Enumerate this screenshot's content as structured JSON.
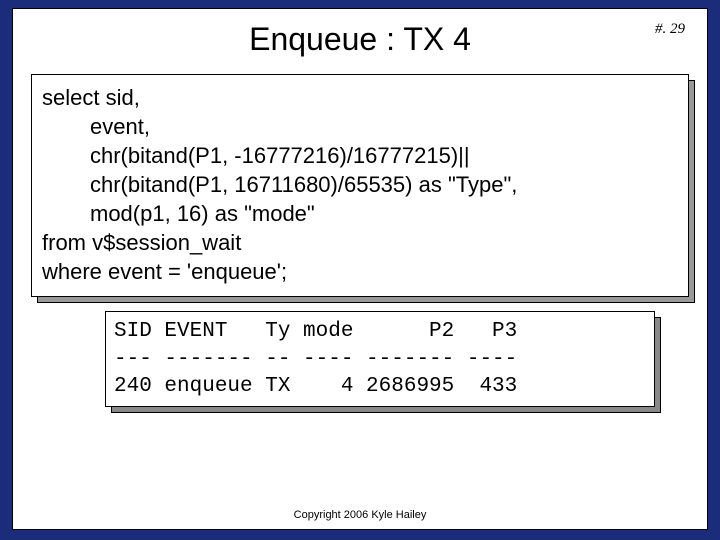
{
  "page_number": "#. 29",
  "title": "Enqueue : TX 4",
  "sql": {
    "l1": "select sid,",
    "l2": "event,",
    "l3": "chr(bitand(P1, -16777216)/16777215)||",
    "l4": "chr(bitand(P1, 16711680)/65535) as \"Type\",",
    "l5": "mod(p1, 16)  as \"mode\"",
    "l6": "from v$session_wait",
    "l7": "where event = 'enqueue';"
  },
  "result": {
    "header": "SID EVENT   Ty mode      P2   P3",
    "divider": "--- ------- -- ---- ------- ----",
    "row": "240 enqueue TX    4 2686995  433"
  },
  "copyright": "Copyright 2006 Kyle Hailey",
  "chart_data": {
    "type": "table",
    "columns": [
      "SID",
      "EVENT",
      "Ty",
      "mode",
      "P2",
      "P3"
    ],
    "rows": [
      [
        240,
        "enqueue",
        "TX",
        4,
        2686995,
        433
      ]
    ]
  }
}
